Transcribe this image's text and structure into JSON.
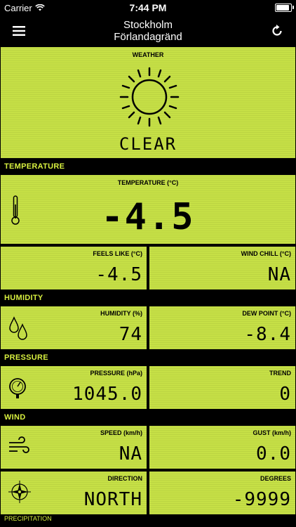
{
  "status": {
    "carrier": "Carrier",
    "time": "7:44 PM",
    "battery_fill": 1.0
  },
  "nav": {
    "title_line1": "Stockholm",
    "title_line2": "Förlandagränd",
    "menu_icon": "hamburger-icon",
    "refresh_icon": "refresh-icon"
  },
  "weather": {
    "label": "WEATHER",
    "condition": "CLEAR",
    "icon": "sun-icon"
  },
  "temperature": {
    "section": "TEMPERATURE",
    "main_label": "TEMPERATURE (°C)",
    "main_value": "-4.5",
    "feels_label": "FEELS LIKE (°C)",
    "feels_value": "-4.5",
    "chill_label": "WIND CHILL (°C)",
    "chill_value": "NA"
  },
  "humidity": {
    "section": "HUMIDITY",
    "hum_label": "HUMIDITY (%)",
    "hum_value": "74",
    "dew_label": "DEW POINT (°C)",
    "dew_value": "-8.4"
  },
  "pressure": {
    "section": "PRESSURE",
    "p_label": "PRESSURE (hPa)",
    "p_value": "1045.0",
    "trend_label": "TREND",
    "trend_value": "0"
  },
  "wind": {
    "section": "WIND",
    "speed_label": "SPEED (km/h)",
    "speed_value": "NA",
    "gust_label": "GUST (km/h)",
    "gust_value": "0.0",
    "dir_label": "DIRECTION",
    "dir_value": "NORTH",
    "deg_label": "DEGREES",
    "deg_value": "-9999"
  },
  "next_section": "PRECIPITATION"
}
